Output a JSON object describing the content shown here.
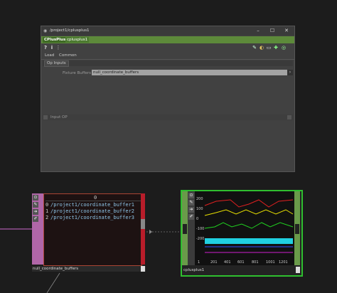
{
  "window": {
    "title": "/project1/cplusplus1",
    "min": "–",
    "max": "☐",
    "close": "✕"
  },
  "op_header": {
    "type": "CPlusPlus",
    "name": "cplusplus1"
  },
  "toolbar": {
    "icons": [
      "eyedropper-icon",
      "palette-icon",
      "comment-icon",
      "plus-icon",
      "target-icon"
    ],
    "help": "?",
    "info": "i"
  },
  "page_tabs": [
    "Load",
    "Common"
  ],
  "sub_tab": "Op Inputs",
  "param": {
    "label": "Fixture Buffers DAT",
    "value": "null_coordinate_buffers"
  },
  "input_op": {
    "label": "Input OP"
  },
  "dat_node": {
    "header": "0",
    "rows": [
      {
        "idx": "0",
        "text": "/project1/coordinate_buffer1"
      },
      {
        "idx": "1",
        "text": "/project1/coordinate_buffer2"
      },
      {
        "idx": "2",
        "text": "/project1/coordinate_buffer3"
      }
    ],
    "label": "null_coordinate_buffers"
  },
  "cpp_node": {
    "label": "cplusplus1",
    "y_ticks": [
      "200",
      "100",
      "0",
      "-100",
      "-200"
    ],
    "x_ticks": [
      "1",
      "201",
      "401",
      "601",
      "801",
      "1001",
      "1201"
    ],
    "colors": {
      "red": "#e02020",
      "yellow": "#e8e000",
      "green": "#20d020",
      "cyan": "#20d0e0",
      "blue": "#3050ff",
      "magenta": "#d020d0"
    }
  }
}
